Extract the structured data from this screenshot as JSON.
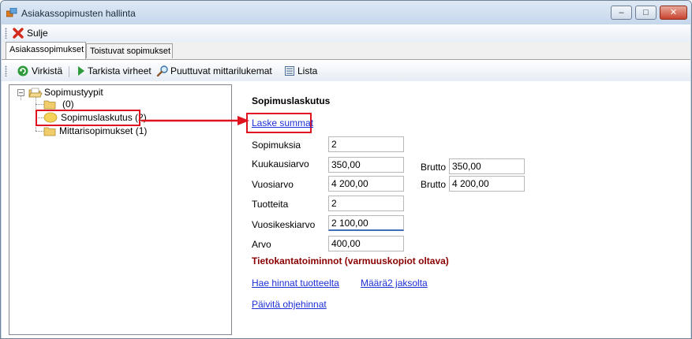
{
  "window": {
    "title": "Asiakassopimusten hallinta"
  },
  "toolbar": {
    "close_label": "Sulje"
  },
  "tabs": [
    {
      "label": "Asiakassopimukset",
      "active": true
    },
    {
      "label": "Toistuvat sopimukset",
      "active": false
    }
  ],
  "actions": {
    "refresh": "Virkistä",
    "check_errors": "Tarkista virheet",
    "missing_readings": "Puuttuvat mittarilukemat",
    "list": "Lista"
  },
  "tree": {
    "root": "Sopimustyypit",
    "children": [
      {
        "label": "(0)",
        "selected": false
      },
      {
        "label": "Sopimuslaskutus (2)",
        "selected": true
      },
      {
        "label": "Mittarisopimukset (1)",
        "selected": false
      }
    ]
  },
  "details": {
    "title": "Sopimuslaskutus",
    "calc_link": "Laske summat",
    "fields": {
      "contracts": {
        "label": "Sopimuksia",
        "value": "2"
      },
      "monthly": {
        "label": "Kuukausiarvo",
        "value": "350,00"
      },
      "monthly_gross": {
        "label": "Brutto",
        "value": "350,00"
      },
      "yearly": {
        "label": "Vuosiarvo",
        "value": "4 200,00"
      },
      "yearly_gross": {
        "label": "Brutto",
        "value": "4 200,00"
      },
      "products": {
        "label": "Tuotteita",
        "value": "2"
      },
      "yearly_avg": {
        "label": "Vuosikeskiarvo",
        "value": "2 100,00"
      },
      "value": {
        "label": "Arvo",
        "value": "400,00"
      }
    },
    "db_ops_title": "Tietokantatoiminnot (varmuuskopiot oltava)",
    "db_links": {
      "fetch_prices": "Hae hinnat tuotteelta",
      "amount_by_period": "Määrä2 jaksolta",
      "update_instructions": "Päivitä ohjehinnat"
    }
  },
  "colors": {
    "highlight": "#e0141e",
    "link": "#1c2fd6",
    "db_heading": "#8b0000"
  }
}
